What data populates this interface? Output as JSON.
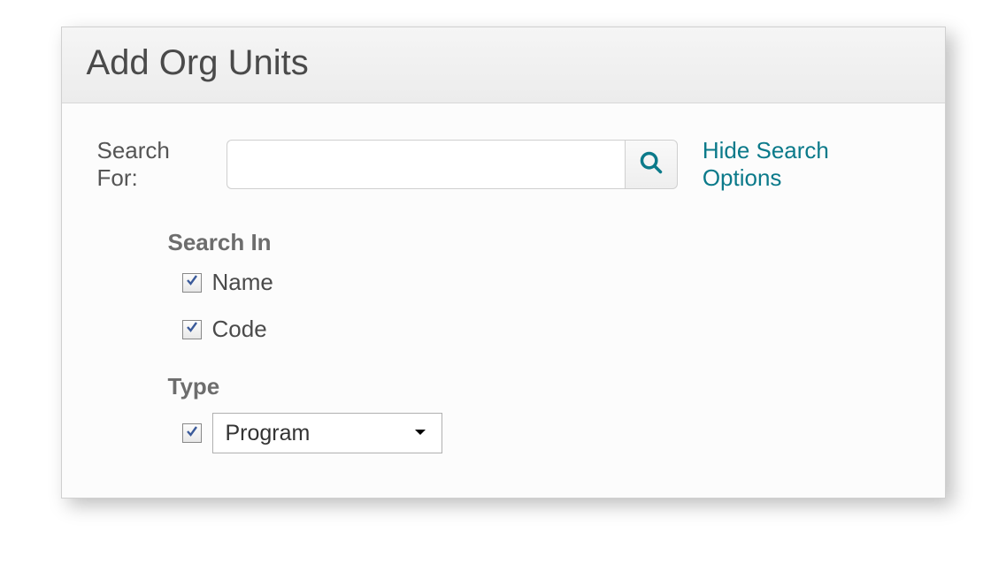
{
  "header": {
    "title": "Add Org Units"
  },
  "search": {
    "label": "Search For:",
    "value": "",
    "placeholder": ""
  },
  "toggle": {
    "hide_label": "Hide Search Options"
  },
  "search_in": {
    "heading": "Search In",
    "options": [
      {
        "label": "Name",
        "checked": true
      },
      {
        "label": "Code",
        "checked": true
      }
    ]
  },
  "type_section": {
    "heading": "Type",
    "checked": true,
    "selected": "Program"
  }
}
